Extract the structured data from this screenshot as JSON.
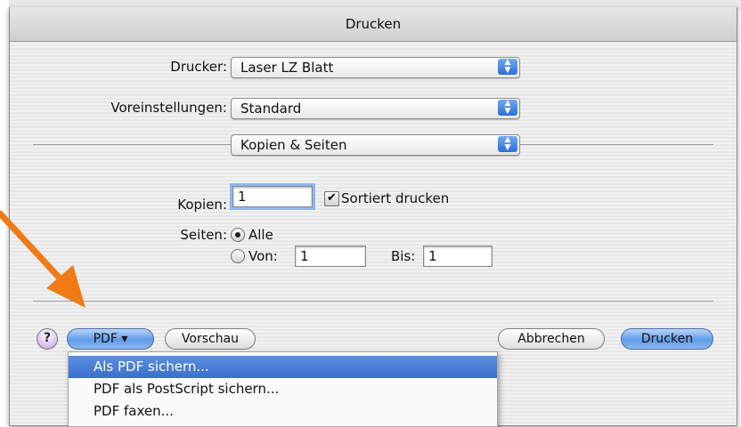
{
  "dialog": {
    "title": "Drucken",
    "printer_label": "Drucker:",
    "printer_value": "Laser LZ Blatt",
    "presets_label": "Voreinstellungen:",
    "presets_value": "Standard",
    "section_value": "Kopien & Seiten",
    "copies_label": "Kopien:",
    "copies_value": "1",
    "collate_label": "Sortiert drucken",
    "collate_checked": true,
    "pages_label": "Seiten:",
    "pages_all_label": "Alle",
    "pages_from_label": "Von:",
    "pages_from_value": "1",
    "pages_to_label": "Bis:",
    "pages_to_value": "1"
  },
  "buttons": {
    "help": "?",
    "pdf": "PDF ▾",
    "preview": "Vorschau",
    "cancel": "Abbrechen",
    "print": "Drucken"
  },
  "pdf_menu": {
    "items": [
      "Als PDF sichern...",
      "PDF als PostScript sichern...",
      "PDF faxen..."
    ],
    "selected_index": 0
  },
  "icons": {
    "popup_arrows": "up-down-arrows-icon",
    "checkmark": "checkmark-icon",
    "annotation_arrow": "orange-arrow-icon"
  },
  "colors": {
    "accent_blue": "#3a6fcd",
    "annotation_orange": "#f07a14"
  }
}
